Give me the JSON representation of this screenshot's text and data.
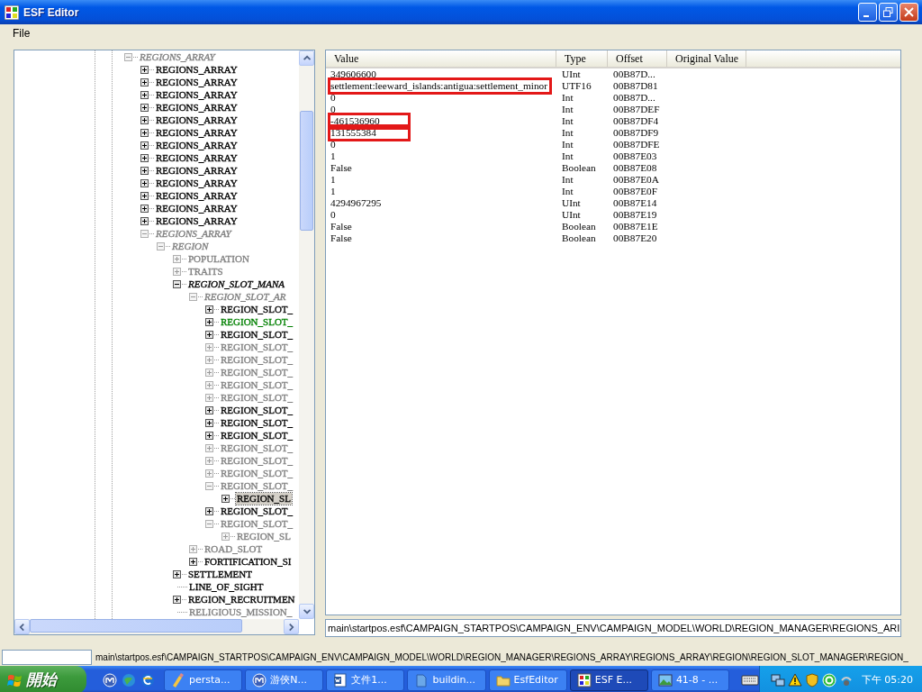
{
  "window": {
    "title": "ESF Editor"
  },
  "menu": [
    "File"
  ],
  "tree": {
    "items": [
      {
        "label": "REGIONS_ARRAY",
        "kind": "branch",
        "expanded": true,
        "italic": true,
        "color": "#808080",
        "selected": false,
        "children": [
          {
            "label": "REGIONS_ARRAY",
            "kind": "branch",
            "expanded": false,
            "italic": false,
            "color": "#000000",
            "selected": false
          },
          {
            "label": "REGIONS_ARRAY",
            "kind": "branch",
            "expanded": false,
            "italic": false,
            "color": "#000000",
            "selected": false
          },
          {
            "label": "REGIONS_ARRAY",
            "kind": "branch",
            "expanded": false,
            "italic": false,
            "color": "#000000",
            "selected": false
          },
          {
            "label": "REGIONS_ARRAY",
            "kind": "branch",
            "expanded": false,
            "italic": false,
            "color": "#000000",
            "selected": false
          },
          {
            "label": "REGIONS_ARRAY",
            "kind": "branch",
            "expanded": false,
            "italic": false,
            "color": "#000000",
            "selected": false
          },
          {
            "label": "REGIONS_ARRAY",
            "kind": "branch",
            "expanded": false,
            "italic": false,
            "color": "#000000",
            "selected": false
          },
          {
            "label": "REGIONS_ARRAY",
            "kind": "branch",
            "expanded": false,
            "italic": false,
            "color": "#000000",
            "selected": false
          },
          {
            "label": "REGIONS_ARRAY",
            "kind": "branch",
            "expanded": false,
            "italic": false,
            "color": "#000000",
            "selected": false
          },
          {
            "label": "REGIONS_ARRAY",
            "kind": "branch",
            "expanded": false,
            "italic": false,
            "color": "#000000",
            "selected": false
          },
          {
            "label": "REGIONS_ARRAY",
            "kind": "branch",
            "expanded": false,
            "italic": false,
            "color": "#000000",
            "selected": false
          },
          {
            "label": "REGIONS_ARRAY",
            "kind": "branch",
            "expanded": false,
            "italic": false,
            "color": "#000000",
            "selected": false
          },
          {
            "label": "REGIONS_ARRAY",
            "kind": "branch",
            "expanded": false,
            "italic": false,
            "color": "#000000",
            "selected": false
          },
          {
            "label": "REGIONS_ARRAY",
            "kind": "branch",
            "expanded": false,
            "italic": false,
            "color": "#000000",
            "selected": false
          },
          {
            "label": "REGIONS_ARRAY",
            "kind": "branch",
            "expanded": true,
            "italic": true,
            "color": "#808080",
            "selected": false,
            "children": [
              {
                "label": "REGION",
                "kind": "branch",
                "expanded": true,
                "italic": true,
                "color": "#808080",
                "selected": false,
                "children": [
                  {
                    "label": "POPULATION",
                    "kind": "branch",
                    "expanded": false,
                    "italic": false,
                    "color": "#808080",
                    "selected": false
                  },
                  {
                    "label": "TRAITS",
                    "kind": "branch",
                    "expanded": false,
                    "italic": false,
                    "color": "#808080",
                    "selected": false
                  },
                  {
                    "label": "REGION_SLOT_MANA",
                    "kind": "branch",
                    "expanded": true,
                    "italic": true,
                    "color": "#000000",
                    "selected": false,
                    "children": [
                      {
                        "label": "REGION_SLOT_AR",
                        "kind": "branch",
                        "expanded": true,
                        "italic": true,
                        "color": "#808080",
                        "selected": false,
                        "children": [
                          {
                            "label": "REGION_SLOT_",
                            "kind": "branch",
                            "expanded": false,
                            "italic": false,
                            "color": "#000000",
                            "selected": false
                          },
                          {
                            "label": "REGION_SLOT_",
                            "kind": "branch",
                            "expanded": false,
                            "italic": false,
                            "color": "#008000",
                            "selected": false
                          },
                          {
                            "label": "REGION_SLOT_",
                            "kind": "branch",
                            "expanded": false,
                            "italic": false,
                            "color": "#000000",
                            "selected": false
                          },
                          {
                            "label": "REGION_SLOT_",
                            "kind": "branch",
                            "expanded": false,
                            "italic": false,
                            "color": "#808080",
                            "selected": false
                          },
                          {
                            "label": "REGION_SLOT_",
                            "kind": "branch",
                            "expanded": false,
                            "italic": false,
                            "color": "#808080",
                            "selected": false
                          },
                          {
                            "label": "REGION_SLOT_",
                            "kind": "branch",
                            "expanded": false,
                            "italic": false,
                            "color": "#808080",
                            "selected": false
                          },
                          {
                            "label": "REGION_SLOT_",
                            "kind": "branch",
                            "expanded": false,
                            "italic": false,
                            "color": "#808080",
                            "selected": false
                          },
                          {
                            "label": "REGION_SLOT_",
                            "kind": "branch",
                            "expanded": false,
                            "italic": false,
                            "color": "#808080",
                            "selected": false
                          },
                          {
                            "label": "REGION_SLOT_",
                            "kind": "branch",
                            "expanded": false,
                            "italic": false,
                            "color": "#000000",
                            "selected": false
                          },
                          {
                            "label": "REGION_SLOT_",
                            "kind": "branch",
                            "expanded": false,
                            "italic": false,
                            "color": "#000000",
                            "selected": false
                          },
                          {
                            "label": "REGION_SLOT_",
                            "kind": "branch",
                            "expanded": false,
                            "italic": false,
                            "color": "#000000",
                            "selected": false
                          },
                          {
                            "label": "REGION_SLOT_",
                            "kind": "branch",
                            "expanded": false,
                            "italic": false,
                            "color": "#808080",
                            "selected": false
                          },
                          {
                            "label": "REGION_SLOT_",
                            "kind": "branch",
                            "expanded": false,
                            "italic": false,
                            "color": "#808080",
                            "selected": false
                          },
                          {
                            "label": "REGION_SLOT_",
                            "kind": "branch",
                            "expanded": false,
                            "italic": false,
                            "color": "#808080",
                            "selected": false
                          },
                          {
                            "label": "REGION_SLOT_",
                            "kind": "branch",
                            "expanded": true,
                            "italic": false,
                            "color": "#808080",
                            "selected": false,
                            "children": [
                              {
                                "label": "REGION_SL",
                                "kind": "branch",
                                "expanded": false,
                                "italic": false,
                                "color": "#000000",
                                "selected": true
                              }
                            ]
                          },
                          {
                            "label": "REGION_SLOT_",
                            "kind": "branch",
                            "expanded": false,
                            "italic": false,
                            "color": "#000000",
                            "selected": false
                          },
                          {
                            "label": "REGION_SLOT_",
                            "kind": "branch",
                            "expanded": true,
                            "italic": false,
                            "color": "#808080",
                            "selected": false,
                            "children": [
                              {
                                "label": "REGION_SL",
                                "kind": "branch",
                                "expanded": false,
                                "italic": false,
                                "color": "#808080",
                                "selected": false
                              }
                            ]
                          }
                        ]
                      },
                      {
                        "label": "ROAD_SLOT",
                        "kind": "branch",
                        "expanded": false,
                        "italic": false,
                        "color": "#808080",
                        "selected": false
                      },
                      {
                        "label": "FORTIFICATION_SI",
                        "kind": "branch",
                        "expanded": false,
                        "italic": false,
                        "color": "#000000",
                        "selected": false
                      }
                    ]
                  },
                  {
                    "label": "SETTLEMENT",
                    "kind": "branch",
                    "expanded": false,
                    "italic": false,
                    "color": "#000000",
                    "selected": false
                  },
                  {
                    "label": "LINE_OF_SIGHT",
                    "kind": "leaf",
                    "italic": false,
                    "color": "#000000",
                    "selected": false
                  },
                  {
                    "label": "REGION_RECRUITMEN",
                    "kind": "branch",
                    "expanded": false,
                    "italic": false,
                    "color": "#000000",
                    "selected": false
                  },
                  {
                    "label": "RELIGIOUS_MISSION_",
                    "kind": "leaf",
                    "italic": false,
                    "color": "#808080",
                    "selected": false
                  }
                ]
              }
            ]
          }
        ]
      }
    ]
  },
  "grid": {
    "columns": [
      "Value",
      "Type",
      "Offset",
      "Original Value"
    ],
    "rows": [
      {
        "value": "349606600",
        "type": "UInt",
        "offset": "00B87D...",
        "highlighted": false
      },
      {
        "value": "settlement:leeward_islands:antigua:settlement_minor",
        "type": "UTF16",
        "offset": "00B87D81",
        "highlighted": true
      },
      {
        "value": "0",
        "type": "Int",
        "offset": "00B87D...",
        "highlighted": false
      },
      {
        "value": "0",
        "type": "Int",
        "offset": "00B87DEF",
        "highlighted": false
      },
      {
        "value": "-461536960",
        "type": "Int",
        "offset": "00B87DF4",
        "highlighted": true
      },
      {
        "value": "131555384",
        "type": "Int",
        "offset": "00B87DF9",
        "highlighted": true
      },
      {
        "value": "0",
        "type": "Int",
        "offset": "00B87DFE",
        "highlighted": false
      },
      {
        "value": "1",
        "type": "Int",
        "offset": "00B87E03",
        "highlighted": false
      },
      {
        "value": "False",
        "type": "Boolean",
        "offset": "00B87E08",
        "highlighted": false
      },
      {
        "value": "1",
        "type": "Int",
        "offset": "00B87E0A",
        "highlighted": false
      },
      {
        "value": "1",
        "type": "Int",
        "offset": "00B87E0F",
        "highlighted": false
      },
      {
        "value": "4294967295",
        "type": "UInt",
        "offset": "00B87E14",
        "highlighted": false
      },
      {
        "value": "0",
        "type": "UInt",
        "offset": "00B87E19",
        "highlighted": false
      },
      {
        "value": "False",
        "type": "Boolean",
        "offset": "00B87E1E",
        "highlighted": false
      },
      {
        "value": "False",
        "type": "Boolean",
        "offset": "00B87E20",
        "highlighted": false
      }
    ]
  },
  "path_field": {
    "value": "main\\startpos.esf\\CAMPAIGN_STARTPOS\\CAMPAIGN_ENV\\CAMPAIGN_MODEL\\WORLD\\REGION_MANAGER\\REGIONS_ARI"
  },
  "status_bar": {
    "text": "main\\startpos.esf\\CAMPAIGN_STARTPOS\\CAMPAIGN_ENV\\CAMPAIGN_MODEL\\WORLD\\REGION_MANAGER\\REGIONS_ARRAY\\REGIONS_ARRAY\\REGION\\REGION_SLOT_MANAGER\\REGION_"
  },
  "taskbar": {
    "start": "開始",
    "tasks": [
      {
        "label": "persta...",
        "selected": false
      },
      {
        "label": "游俠N...",
        "selected": false
      },
      {
        "label": "文件1...",
        "selected": false
      },
      {
        "label": "buildin...",
        "selected": false
      },
      {
        "label": "EsfEditor",
        "selected": false
      },
      {
        "label": "ESF E...",
        "selected": true
      },
      {
        "label": "41-8 - ...",
        "selected": false
      }
    ],
    "clock": "下午 05:20"
  }
}
